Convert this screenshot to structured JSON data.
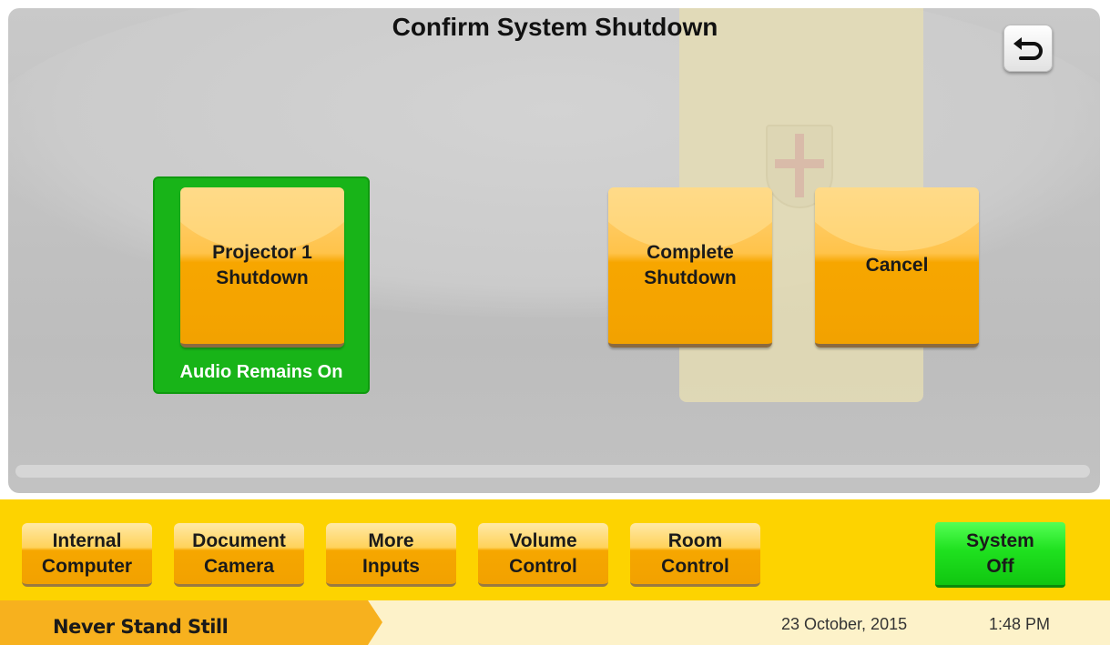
{
  "dialog": {
    "title": "Confirm System Shutdown",
    "back_icon": "undo-arrow-icon"
  },
  "options": {
    "projector_shutdown": "Projector 1\nShutdown",
    "projector_caption": "Audio Remains On",
    "complete_shutdown": "Complete\nShutdown",
    "cancel": "Cancel"
  },
  "navbar": {
    "items": [
      {
        "label": "Internal\nComputer"
      },
      {
        "label": "Document\nCamera"
      },
      {
        "label": "More\nInputs"
      },
      {
        "label": "Volume\nControl"
      },
      {
        "label": "Room\nControl"
      }
    ],
    "system_off": "System\nOff"
  },
  "footer": {
    "tagline": "Never Stand Still",
    "date": "23 October, 2015",
    "time": "1:48 PM"
  },
  "colors": {
    "navbar": "#fdd300",
    "tile_orange": "#f7a600",
    "active_green": "#18b418",
    "system_off_green": "#1fe11f"
  }
}
